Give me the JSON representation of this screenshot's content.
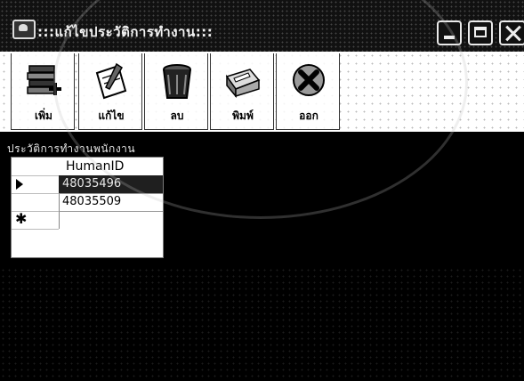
{
  "window": {
    "title": ":::แก้ไขประวัติการทำงาน:::",
    "minimize_icon": "minimize-icon",
    "maximize_icon": "maximize-icon",
    "close_icon": "close-icon"
  },
  "toolbar": {
    "buttons": [
      {
        "label": "เพิ่ม",
        "icon": "add-books-icon"
      },
      {
        "label": "แก้ไข",
        "icon": "edit-pencil-icon"
      },
      {
        "label": "ลบ",
        "icon": "trash-bin-icon"
      },
      {
        "label": "พิมพ์",
        "icon": "printer-icon"
      },
      {
        "label": "ออก",
        "icon": "exit-x-icon"
      }
    ]
  },
  "section": {
    "title": "ประวัติการทำงานพนักงาน"
  },
  "grid": {
    "columns": [
      "HumanID"
    ],
    "rows": [
      {
        "HumanID": "48035496",
        "selected": true
      },
      {
        "HumanID": "48035509",
        "selected": false
      }
    ],
    "current_row_icon": "row-pointer-icon",
    "new_row_icon": "new-row-asterisk-icon"
  },
  "colors": {
    "background": "#000000",
    "toolbar": "#ffffff",
    "selected_row": "#1f1f1f"
  }
}
